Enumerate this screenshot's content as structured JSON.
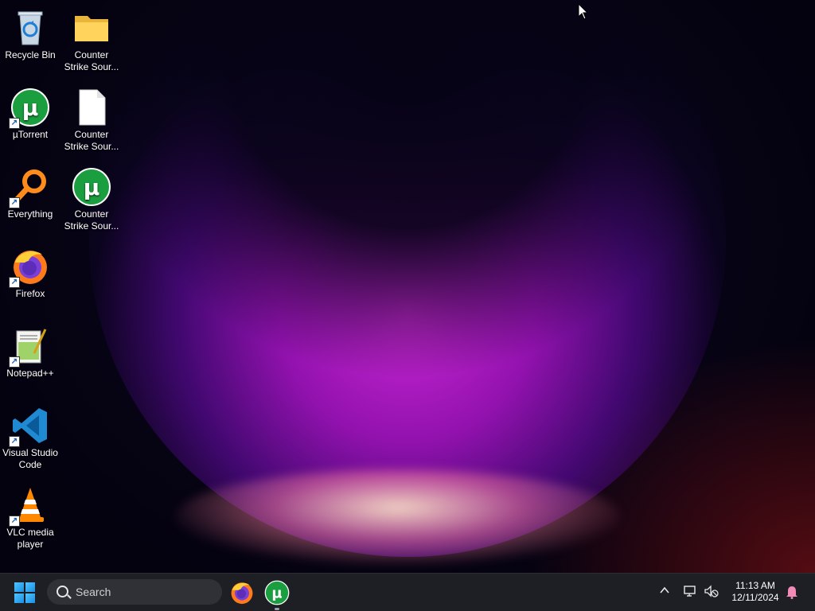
{
  "desktop": {
    "icons": [
      {
        "label": "Recycle Bin",
        "icon": "recycle-bin-icon"
      },
      {
        "label": "Counter Strike Sour...",
        "icon": "folder-icon"
      },
      {
        "label": "µTorrent",
        "icon": "utorrent-icon"
      },
      {
        "label": "Counter Strike Sour...",
        "icon": "file-icon"
      },
      {
        "label": "Everything",
        "icon": "everything-search-icon"
      },
      {
        "label": "Counter Strike Sour...",
        "icon": "utorrent-icon"
      },
      {
        "label": "Firefox",
        "icon": "firefox-icon"
      },
      {
        "label": "Notepad++",
        "icon": "notepad-plus-plus-icon"
      },
      {
        "label": "Visual Studio Code",
        "icon": "vscode-icon"
      },
      {
        "label": "VLC media player",
        "icon": "vlc-icon"
      }
    ]
  },
  "taskbar": {
    "search_placeholder": "Search",
    "pinned_apps": [
      "firefox-icon",
      "utorrent-icon"
    ],
    "tray": {
      "time": "11:13 AM",
      "date": "12/11/2024"
    }
  },
  "colors": {
    "taskbar_bg": "#1d1f24",
    "accent": "#52c4ff",
    "utorrent_green": "#1a9e3f"
  }
}
